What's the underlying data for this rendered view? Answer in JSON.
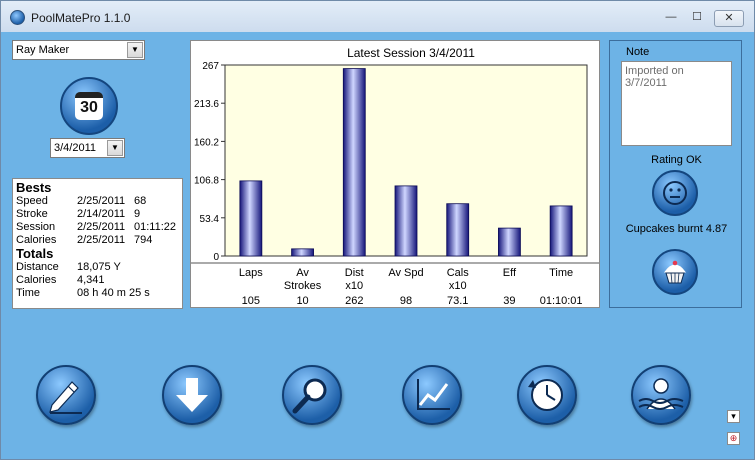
{
  "window": {
    "title": "PoolMatePro 1.1.0",
    "close_label": "✕",
    "min_label": "—",
    "max_label": "☐"
  },
  "user_select": {
    "value": "Ray Maker"
  },
  "calendar_button": {
    "day": "30"
  },
  "date_select": {
    "value": "3/4/2011"
  },
  "bests": {
    "heading": "Bests",
    "rows": [
      {
        "label": "Speed",
        "date": "2/25/2011",
        "value": "68"
      },
      {
        "label": "Stroke",
        "date": "2/14/2011",
        "value": "9"
      },
      {
        "label": "Session",
        "date": "2/25/2011",
        "value": "01:11:22"
      },
      {
        "label": "Calories",
        "date": "2/25/2011",
        "value": "794"
      }
    ],
    "totals_heading": "Totals",
    "totals": [
      {
        "label": "Distance",
        "value": "18,075 Y"
      },
      {
        "label": "Calories",
        "value": "4,341"
      },
      {
        "label": "Time",
        "value": "08 h 40 m 25 s"
      }
    ]
  },
  "chart_data": {
    "type": "bar",
    "title": "Latest Session 3/4/2011",
    "ylim": [
      0,
      267
    ],
    "yticks": [
      "0",
      "53.4",
      "106.8",
      "160.2",
      "213.6",
      "267"
    ],
    "categories": [
      {
        "l1": "Laps",
        "l2": ""
      },
      {
        "l1": "Av",
        "l2": "Strokes"
      },
      {
        "l1": "Dist",
        "l2": "x10"
      },
      {
        "l1": "Av Spd",
        "l2": ""
      },
      {
        "l1": "Cals",
        "l2": "x10"
      },
      {
        "l1": "Eff",
        "l2": ""
      },
      {
        "l1": "Time",
        "l2": ""
      }
    ],
    "values": [
      105,
      10,
      262,
      98,
      73.1,
      39,
      70
    ],
    "value_labels": [
      "105",
      "10",
      "262",
      "98",
      "73.1",
      "39",
      "01:10:01"
    ],
    "grid": false,
    "colors": {
      "plot_bg": "#ffffe3",
      "bar_light": "#cfd6ff",
      "bar_dark": "#15157a"
    }
  },
  "note": {
    "label": "Note",
    "text": "Imported on 3/7/2011"
  },
  "rating": {
    "label": "Rating OK"
  },
  "cupcakes": {
    "label": "Cupcakes burnt 4.87"
  },
  "toolbar": {
    "edit": "pencil-icon",
    "download": "download-arrow-icon",
    "search": "magnifier-icon",
    "chart": "line-chart-icon",
    "history": "history-clock-icon",
    "swimmer": "swimmer-profile-icon"
  },
  "tiny_buttons": {
    "filter": "▾",
    "help": "⊕"
  }
}
